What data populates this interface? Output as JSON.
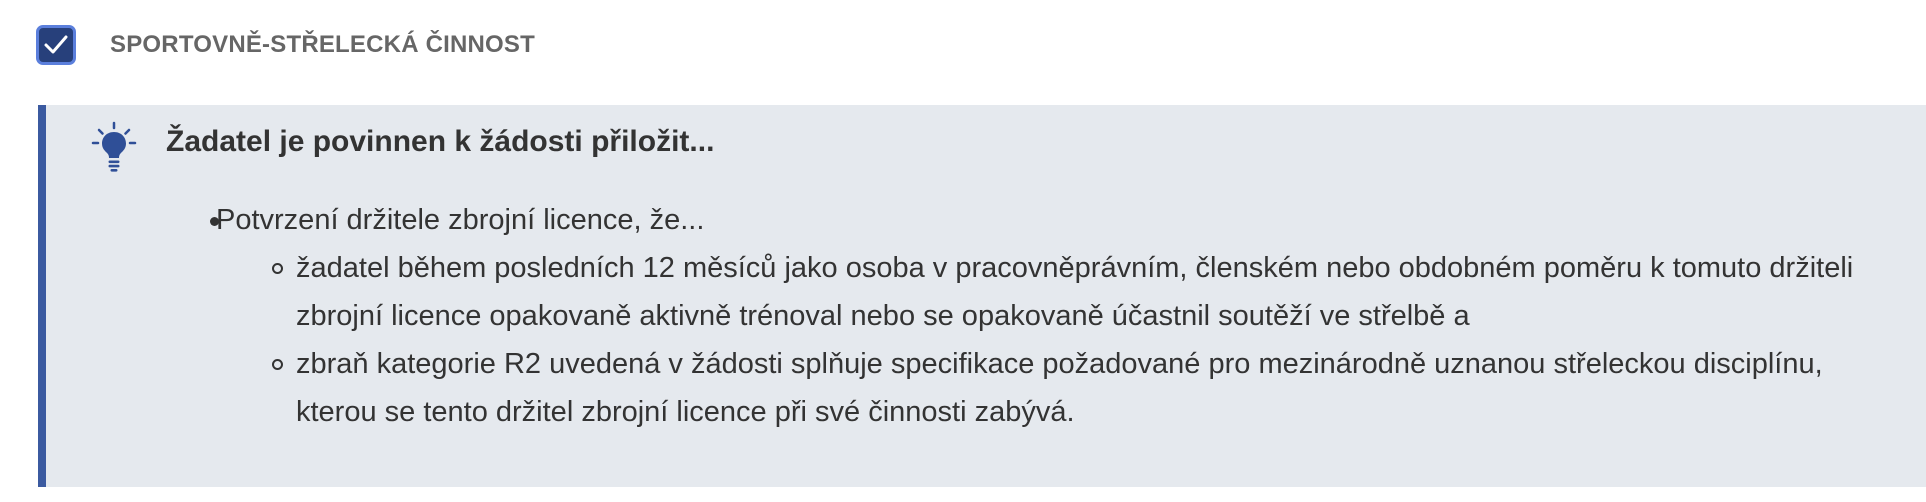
{
  "checkbox": {
    "checked": true,
    "label": "SPORTOVNĚ-STŘELECKÁ ČINNOST"
  },
  "info": {
    "icon": "lightbulb-icon",
    "title": "Žadatel je povinnen k žádosti přiložit...",
    "items": [
      {
        "text": "Potvrzení držitele zbrojní licence, že...",
        "subitems": [
          "žadatel během posledních 12 měsíců jako osoba v pracovněprávním, členském nebo obdobném poměru k tomuto držiteli zbrojní licence opakovaně aktivně trénoval nebo se opakovaně účastnil soutěží ve střelbě a",
          "zbraň kategorie R2 uvedená v žádosti splňuje specifikace požadované pro mezinárodně uznanou střeleckou disciplínu, kterou se tento držitel zbrojní licence při své činnosti zabývá."
        ]
      }
    ]
  },
  "colors": {
    "checkbox_fill": "#27407b",
    "checkbox_border": "#5b7fdc",
    "info_background": "#e5e9ee",
    "info_accent": "#3b5aa0",
    "bulb": "#2f4f97"
  }
}
